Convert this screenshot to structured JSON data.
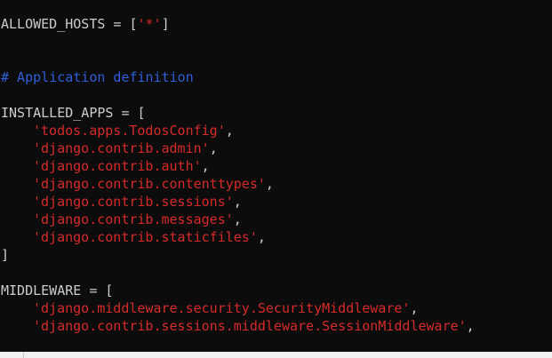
{
  "code": {
    "allowed_hosts": {
      "name": "ALLOWED_HOSTS = [",
      "value": "'*'",
      "close": "]"
    },
    "comment": "# Application definition",
    "installed_apps": {
      "open": "INSTALLED_APPS = [",
      "items": [
        "'todos.apps.TodosConfig'",
        "'django.contrib.admin'",
        "'django.contrib.auth'",
        "'django.contrib.contenttypes'",
        "'django.contrib.sessions'",
        "'django.contrib.messages'",
        "'django.contrib.staticfiles'"
      ],
      "close": "]"
    },
    "middleware": {
      "open": "MIDDLEWARE = [",
      "items": [
        "'django.middleware.security.SecurityMiddleware'",
        "'django.contrib.sessions.middleware.SessionMiddleware'"
      ]
    },
    "comma": ","
  },
  "colors": {
    "background": "#0c0c0c",
    "text": "#cccccc",
    "string": "#d52a2a",
    "comment": "#2e5fd8"
  }
}
